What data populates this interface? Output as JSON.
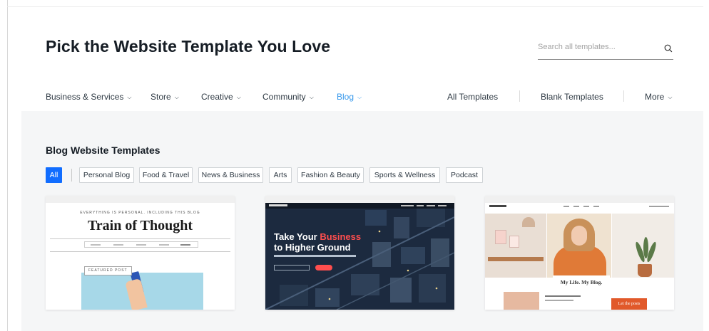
{
  "header": {
    "title": "Pick the Website Template You Love",
    "search_placeholder": "Search all templates..."
  },
  "nav": {
    "categories": [
      {
        "label": "Business & Services"
      },
      {
        "label": "Store"
      },
      {
        "label": "Creative"
      },
      {
        "label": "Community"
      },
      {
        "label": "Blog",
        "active": true
      }
    ],
    "links": [
      {
        "label": "All Templates"
      },
      {
        "label": "Blank Templates"
      },
      {
        "label": "More"
      }
    ]
  },
  "section": {
    "title": "Blog Website Templates",
    "filters": [
      "All",
      "Personal Blog",
      "Food & Travel",
      "News & Business",
      "Arts",
      "Fashion & Beauty",
      "Sports & Wellness",
      "Podcast"
    ],
    "active_filter": "All"
  },
  "templates": [
    {
      "tagline": "EVERYTHING IS PERSONAL. INCLUDING THIS BLOG",
      "title": "Train of Thought",
      "badge": "FEATURED POST"
    },
    {
      "headline_pre": "Take Your ",
      "headline_highlight": "Business",
      "headline_post": "to Higher Ground"
    },
    {
      "caption": "My Life. My Blog.",
      "cta": "Let the posts"
    }
  ],
  "colors": {
    "accent": "#3899ec",
    "active_chip": "#116dff",
    "content_bg": "#f5f6f7",
    "highlight_red": "#ff4e4e"
  }
}
